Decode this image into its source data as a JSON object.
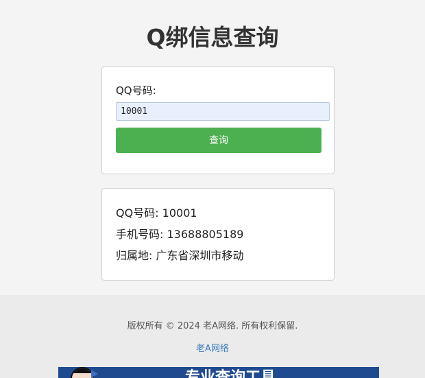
{
  "header": {
    "title": "Q绑信息查询"
  },
  "form": {
    "label": "QQ号码:",
    "input_value": "10001",
    "button_label": "查询"
  },
  "result": {
    "qq_line": "QQ号码: 10001",
    "phone_line": "手机号码: 13688805189",
    "location_line": "归属地: 广东省深圳市移动"
  },
  "footer": {
    "copyright": "版权所有 © 2024 老A网络. 所有权利保留.",
    "link_label": "老A网络",
    "banner_text": "专业查询工具"
  },
  "colors": {
    "accent_button": "#4caf50",
    "link": "#3a7abf",
    "input_background": "#e8f0fe",
    "banner_background": "#1f4a8f"
  },
  "icons": {
    "banner_avatar": "person-avatar-icon"
  }
}
